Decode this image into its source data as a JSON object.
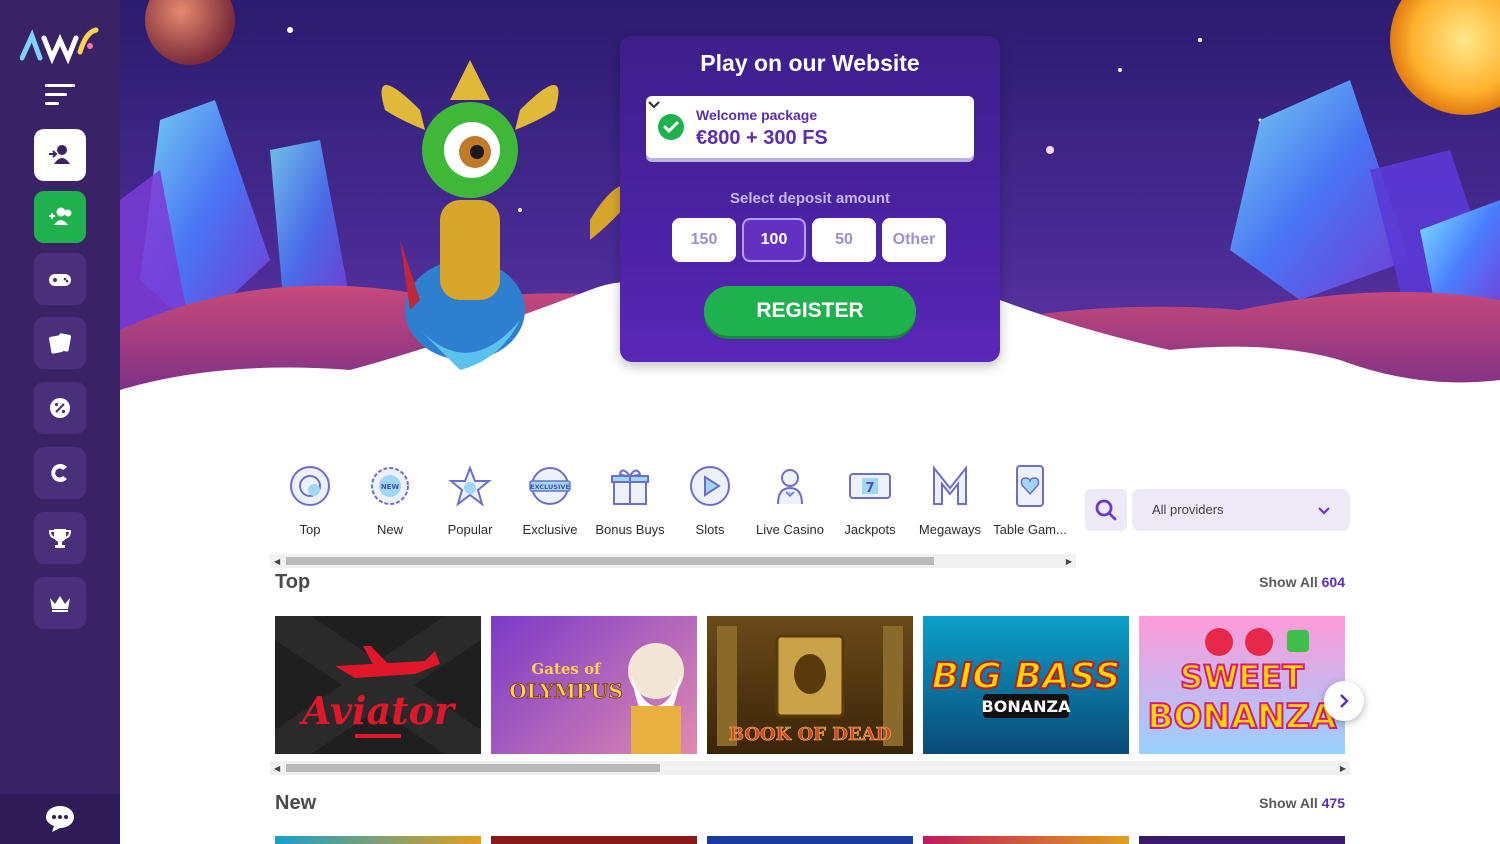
{
  "sidebar": {
    "buttons": [
      {
        "name": "login-button",
        "icon": "user-login-icon"
      },
      {
        "name": "signup-button",
        "icon": "user-add-icon"
      },
      {
        "name": "games-button",
        "icon": "gamepad-icon"
      },
      {
        "name": "cards-button",
        "icon": "cards-icon"
      },
      {
        "name": "promotions-button",
        "icon": "percent-gear-icon"
      },
      {
        "name": "casino-button",
        "icon": "chip-icon"
      },
      {
        "name": "tournaments-button",
        "icon": "trophy-icon"
      },
      {
        "name": "vip-button",
        "icon": "crown-icon"
      }
    ]
  },
  "registration": {
    "title": "Play on our Website",
    "welcome_label": "Welcome package",
    "welcome_amount": "€800 + 300 FS",
    "deposit_label": "Select deposit amount",
    "amounts": [
      "150",
      "100",
      "50",
      "Other"
    ],
    "selected_amount": "100",
    "register_label": "REGISTER"
  },
  "categories": [
    {
      "label": "Top",
      "icon": "chip-icon"
    },
    {
      "label": "New",
      "icon": "new-badge-icon"
    },
    {
      "label": "Popular",
      "icon": "star-icon"
    },
    {
      "label": "Exclusive",
      "icon": "exclusive-badge-icon"
    },
    {
      "label": "Bonus Buys",
      "icon": "gift-icon"
    },
    {
      "label": "Slots",
      "icon": "play-icon"
    },
    {
      "label": "Live Casino",
      "icon": "dealer-icon"
    },
    {
      "label": "Jackpots",
      "icon": "slot-777-icon"
    },
    {
      "label": "Megaways",
      "icon": "megaways-icon"
    },
    {
      "label": "Table Gam...",
      "icon": "card-heart-icon"
    }
  ],
  "providers": {
    "label": "All providers"
  },
  "sections": {
    "top": {
      "title": "Top",
      "show_all": "Show All",
      "count": "604"
    },
    "new": {
      "title": "New",
      "show_all": "Show All",
      "count": "475"
    }
  },
  "top_games": [
    "Aviator",
    "Gates of Olympus",
    "Book of Dead",
    "Big Bass Bonanza",
    "Sweet Bonanza"
  ]
}
